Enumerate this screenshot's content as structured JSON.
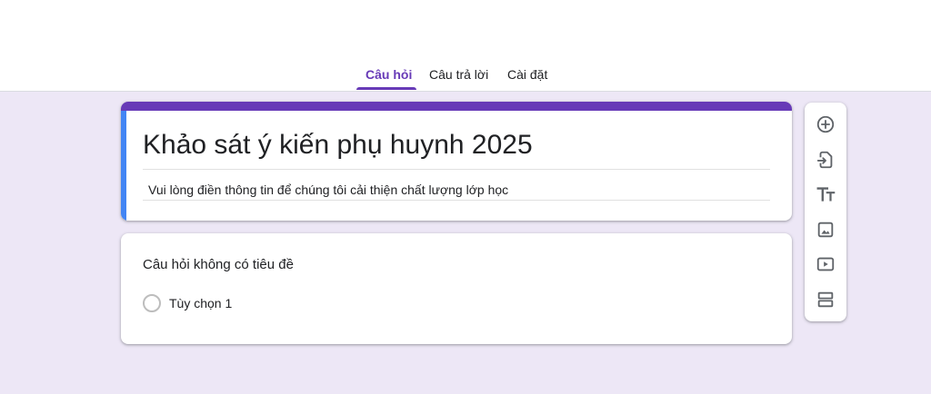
{
  "tabs": [
    {
      "label": "Câu hỏi",
      "active": true
    },
    {
      "label": "Câu trả lời",
      "active": false
    },
    {
      "label": "Cài đặt",
      "active": false
    }
  ],
  "form": {
    "title": "Khảo sát ý kiến phụ huynh 2025",
    "description": "Vui lòng điền thông tin để chúng tôi cải thiện chất lượng lớp học"
  },
  "question": {
    "title": "Câu hỏi không có tiêu đề",
    "options": [
      "Tùy chọn 1"
    ]
  },
  "toolbar": {
    "icons": [
      "add-question-icon",
      "import-questions-icon",
      "add-title-icon",
      "add-image-icon",
      "add-video-icon",
      "add-section-icon"
    ]
  },
  "colors": {
    "accent": "#673ab7",
    "focus_stripe": "#4285f4",
    "background": "#ede7f6"
  }
}
